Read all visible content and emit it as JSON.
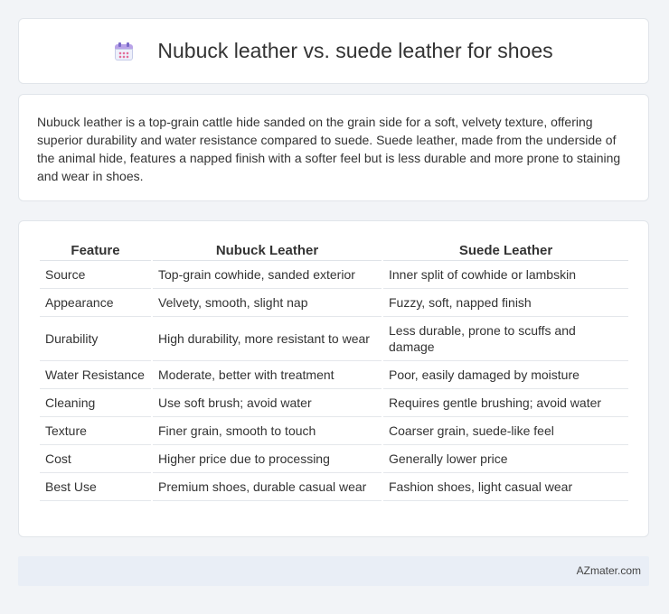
{
  "header": {
    "title": "Nubuck leather vs. suede leather for shoes",
    "icon": "calendar-icon"
  },
  "summary": "Nubuck leather is a top-grain cattle hide sanded on the grain side for a soft, velvety texture, offering superior durability and water resistance compared to suede. Suede leather, made from the underside of the animal hide, features a napped finish with a softer feel but is less durable and more prone to staining and wear in shoes.",
  "table": {
    "headers": [
      "Feature",
      "Nubuck Leather",
      "Suede Leather"
    ],
    "rows": [
      [
        "Source",
        "Top-grain cowhide, sanded exterior",
        "Inner split of cowhide or lambskin"
      ],
      [
        "Appearance",
        "Velvety, smooth, slight nap",
        "Fuzzy, soft, napped finish"
      ],
      [
        "Durability",
        "High durability, more resistant to wear",
        "Less durable, prone to scuffs and damage"
      ],
      [
        "Water Resistance",
        "Moderate, better with treatment",
        "Poor, easily damaged by moisture"
      ],
      [
        "Cleaning",
        "Use soft brush; avoid water",
        "Requires gentle brushing; avoid water"
      ],
      [
        "Texture",
        "Finer grain, smooth to touch",
        "Coarser grain, suede-like feel"
      ],
      [
        "Cost",
        "Higher price due to processing",
        "Generally lower price"
      ],
      [
        "Best Use",
        "Premium shoes, durable casual wear",
        "Fashion shoes, light casual wear"
      ]
    ]
  },
  "footer": {
    "brand": "AZmater.com"
  }
}
